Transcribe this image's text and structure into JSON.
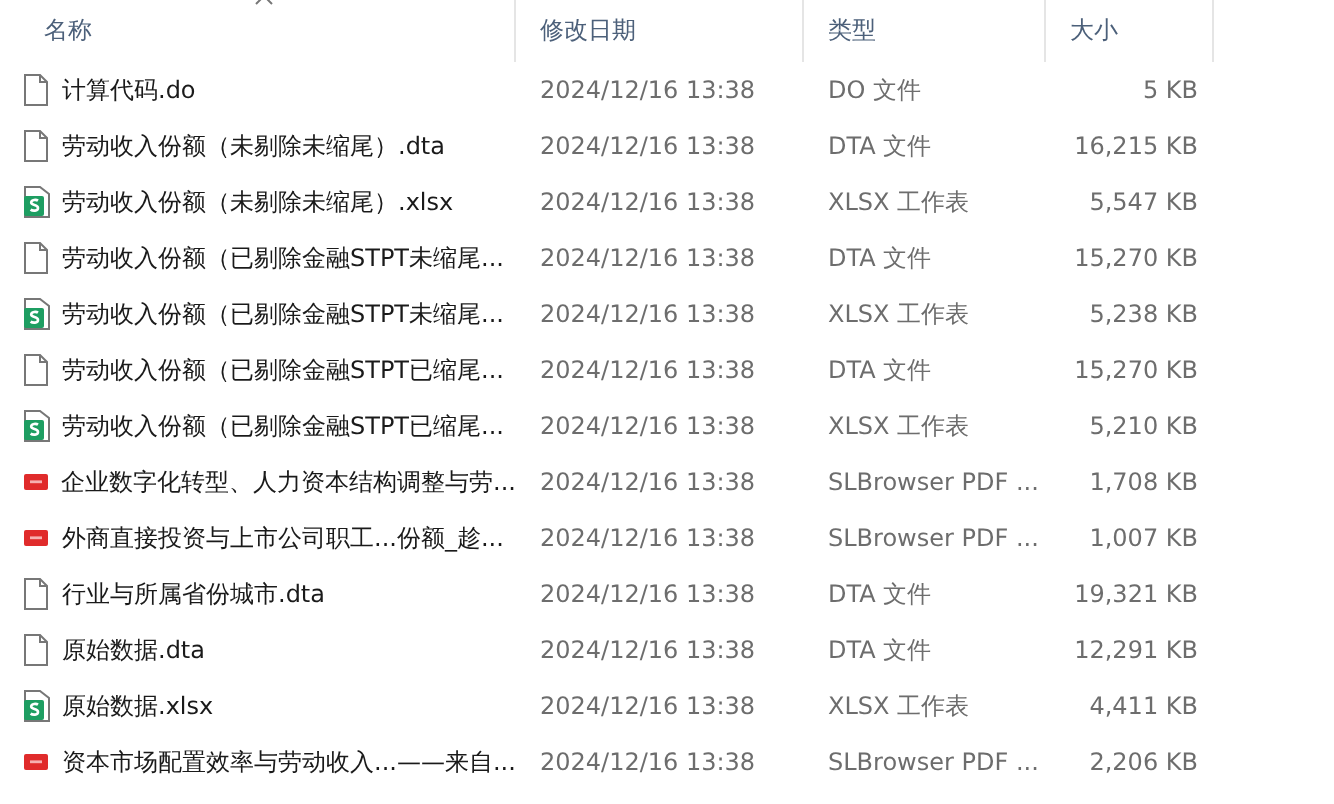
{
  "columns": [
    {
      "label": "名称",
      "sorted": true
    },
    {
      "label": "修改日期",
      "sorted": false
    },
    {
      "label": "类型",
      "sorted": false
    },
    {
      "label": "大小",
      "sorted": false
    }
  ],
  "files": [
    {
      "name": "计算代码.do",
      "modified": "2024/12/16 13:38",
      "type": "DO 文件",
      "size": "5 KB",
      "kind": "plain"
    },
    {
      "name": "劳动收入份额（未剔除未缩尾）.dta",
      "modified": "2024/12/16 13:38",
      "type": "DTA 文件",
      "size": "16,215 KB",
      "kind": "plain"
    },
    {
      "name": "劳动收入份额（未剔除未缩尾）.xlsx",
      "modified": "2024/12/16 13:38",
      "type": "XLSX 工作表",
      "size": "5,547 KB",
      "kind": "sheet"
    },
    {
      "name": "劳动收入份额（已剔除金融STPT未缩尾...",
      "modified": "2024/12/16 13:38",
      "type": "DTA 文件",
      "size": "15,270 KB",
      "kind": "plain"
    },
    {
      "name": "劳动收入份额（已剔除金融STPT未缩尾...",
      "modified": "2024/12/16 13:38",
      "type": "XLSX 工作表",
      "size": "5,238 KB",
      "kind": "sheet"
    },
    {
      "name": "劳动收入份额（已剔除金融STPT已缩尾...",
      "modified": "2024/12/16 13:38",
      "type": "DTA 文件",
      "size": "15,270 KB",
      "kind": "plain"
    },
    {
      "name": "劳动收入份额（已剔除金融STPT已缩尾...",
      "modified": "2024/12/16 13:38",
      "type": "XLSX 工作表",
      "size": "5,210 KB",
      "kind": "sheet"
    },
    {
      "name": "企业数字化转型、人力资本结构调整与劳...",
      "modified": "2024/12/16 13:38",
      "type": "SLBrowser PDF ...",
      "size": "1,708 KB",
      "kind": "pdf"
    },
    {
      "name": "外商直接投资与上市公司职工...份额_趁...",
      "modified": "2024/12/16 13:38",
      "type": "SLBrowser PDF ...",
      "size": "1,007 KB",
      "kind": "pdf"
    },
    {
      "name": "行业与所属省份城市.dta",
      "modified": "2024/12/16 13:38",
      "type": "DTA 文件",
      "size": "19,321 KB",
      "kind": "plain"
    },
    {
      "name": "原始数据.dta",
      "modified": "2024/12/16 13:38",
      "type": "DTA 文件",
      "size": "12,291 KB",
      "kind": "plain"
    },
    {
      "name": "原始数据.xlsx",
      "modified": "2024/12/16 13:38",
      "type": "XLSX 工作表",
      "size": "4,411 KB",
      "kind": "sheet"
    },
    {
      "name": "资本市场配置效率与劳动收入...——来自...",
      "modified": "2024/12/16 13:38",
      "type": "SLBrowser PDF ...",
      "size": "2,206 KB",
      "kind": "pdf"
    }
  ]
}
